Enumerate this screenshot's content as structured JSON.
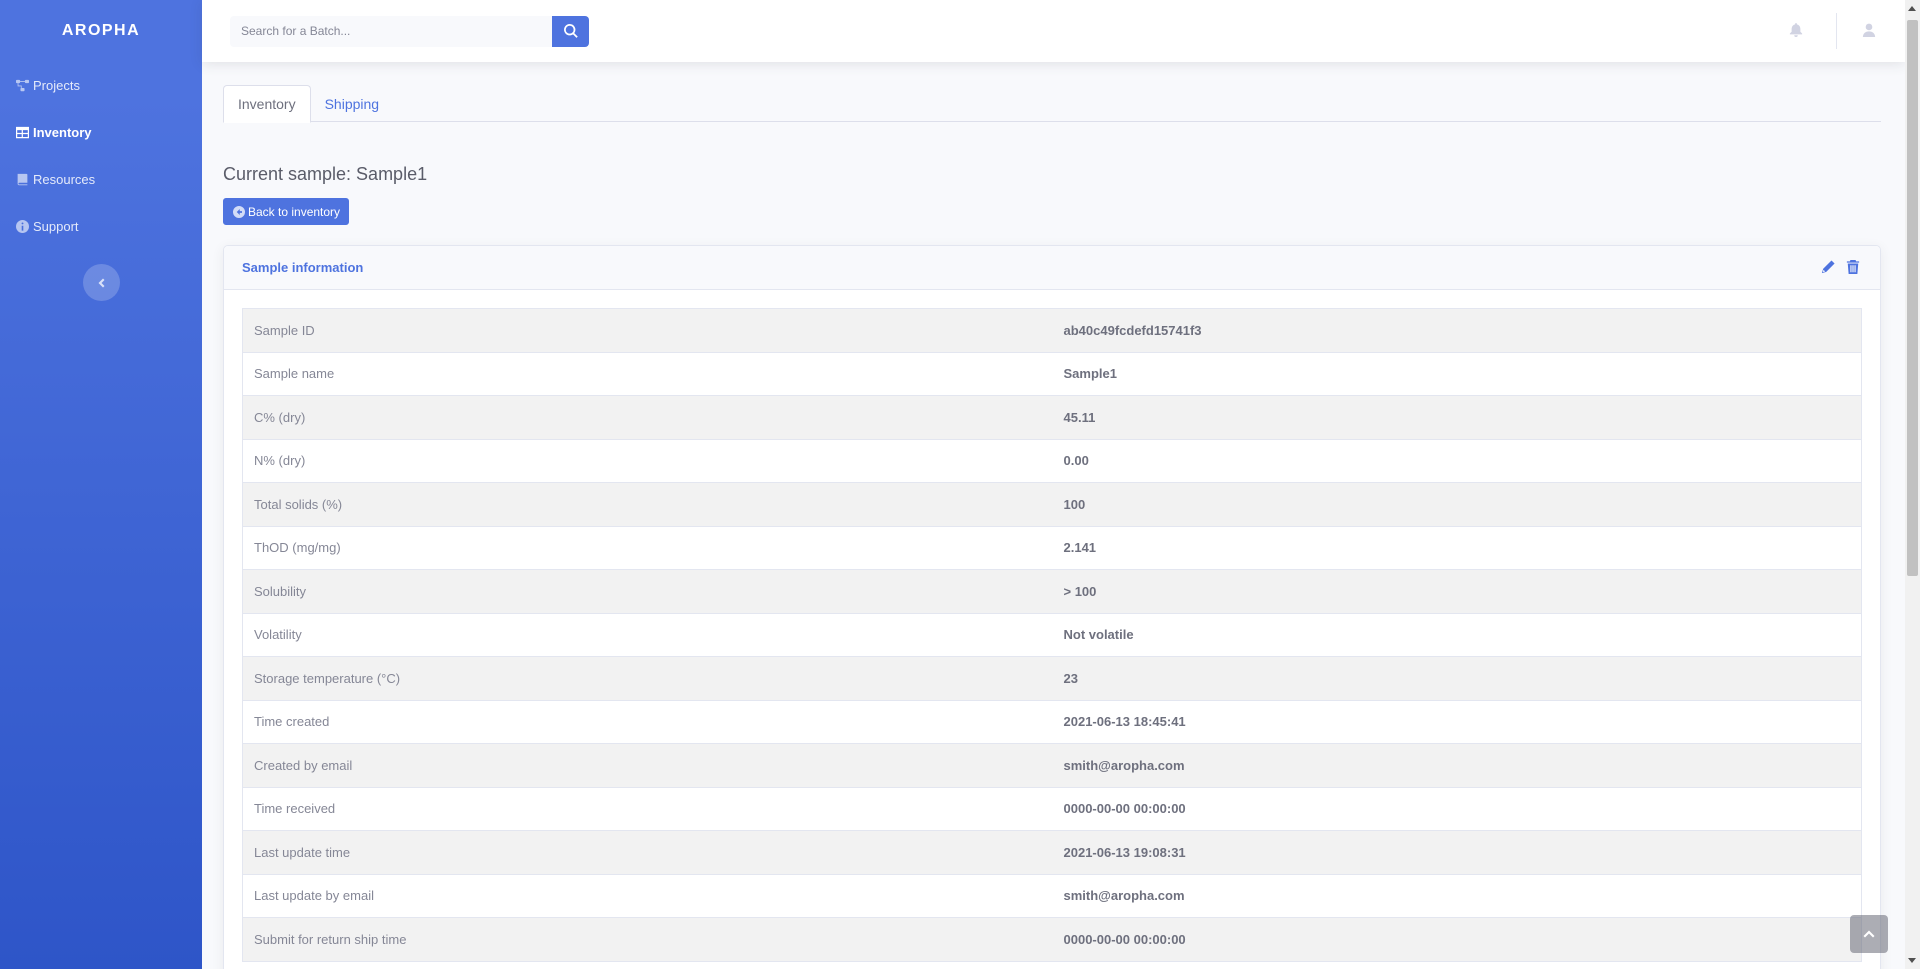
{
  "sidebar": {
    "brand": "AROPHA",
    "items": [
      {
        "label": "Projects",
        "icon": "project-diagram-icon"
      },
      {
        "label": "Inventory",
        "icon": "table-icon"
      },
      {
        "label": "Resources",
        "icon": "book-icon"
      },
      {
        "label": "Support",
        "icon": "info-circle-icon"
      }
    ],
    "active": "Inventory"
  },
  "topbar": {
    "search_placeholder": "Search for a Batch..."
  },
  "tabs": [
    {
      "label": "Inventory",
      "active": true
    },
    {
      "label": "Shipping",
      "active": false
    }
  ],
  "page_title": "Current sample: Sample1",
  "back_button_label": "Back to inventory",
  "card": {
    "title": "Sample information",
    "rows": [
      {
        "label": "Sample ID",
        "value": "ab40c49fcdefd15741f3"
      },
      {
        "label": "Sample name",
        "value": "Sample1"
      },
      {
        "label": "C% (dry)",
        "value": "45.11"
      },
      {
        "label": "N% (dry)",
        "value": "0.00"
      },
      {
        "label": "Total solids (%)",
        "value": "100"
      },
      {
        "label": "ThOD (mg/mg)",
        "value": "2.141"
      },
      {
        "label": "Solubility",
        "value": "> 100"
      },
      {
        "label": "Volatility",
        "value": "Not volatile"
      },
      {
        "label": "Storage temperature (°C)",
        "value": "23"
      },
      {
        "label": "Time created",
        "value": "2021-06-13 18:45:41"
      },
      {
        "label": "Created by email",
        "value": "smith@aropha.com"
      },
      {
        "label": "Time received",
        "value": "0000-00-00 00:00:00"
      },
      {
        "label": "Last update time",
        "value": "2021-06-13 19:08:31"
      },
      {
        "label": "Last update by email",
        "value": "smith@aropha.com"
      },
      {
        "label": "Submit for return ship time",
        "value": "0000-00-00 00:00:00"
      }
    ]
  },
  "colors": {
    "primary": "#4e73df",
    "sidebar_bottom": "#2e55c8",
    "text_muted": "#858796",
    "background": "#f8f9fc"
  }
}
